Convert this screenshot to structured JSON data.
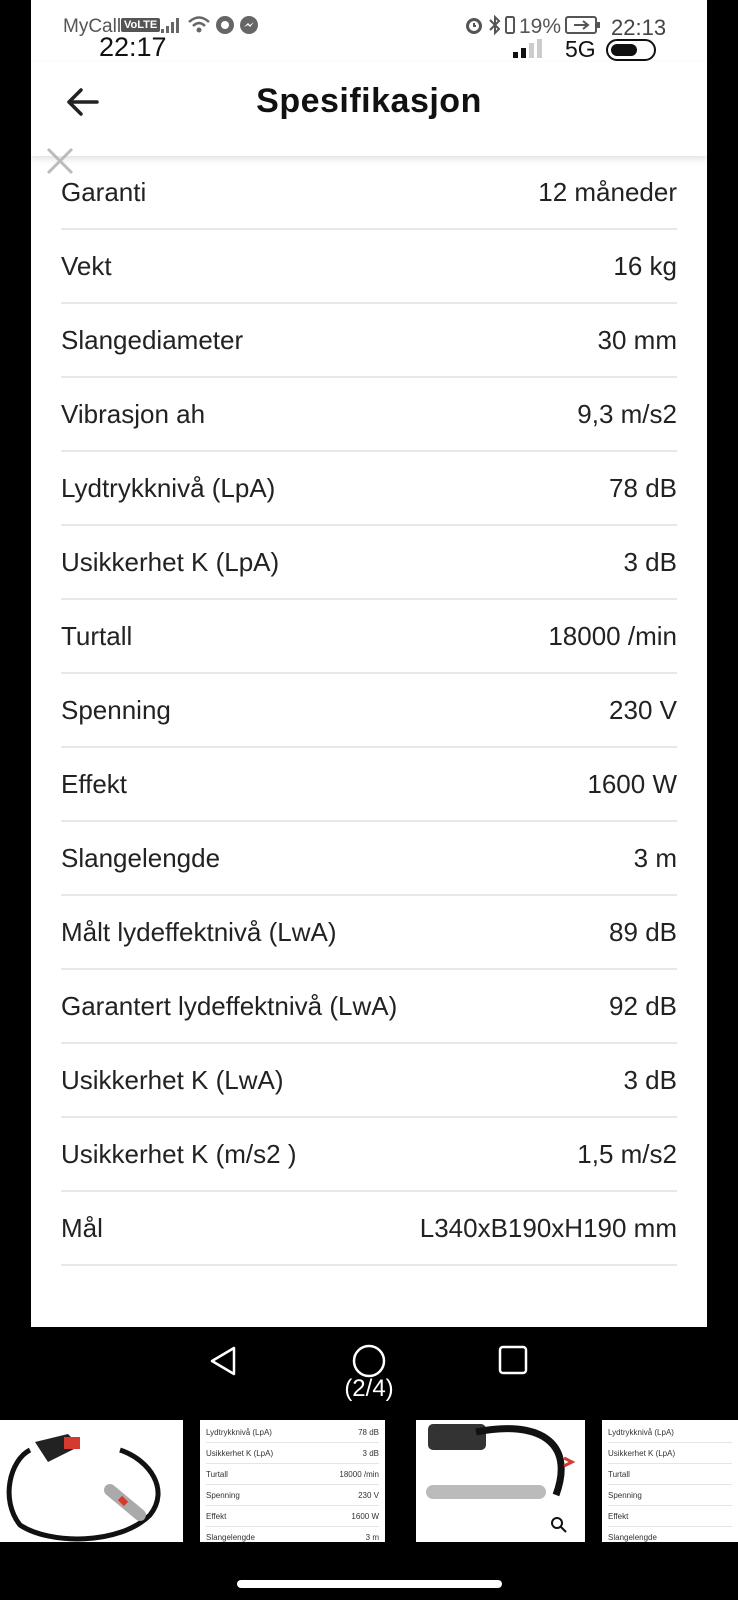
{
  "status_bar": {
    "carrier": "MyCall",
    "volte_badge": "VoLTE",
    "time_large": "22:17",
    "battery_percent": "19%",
    "time_right": "22:13",
    "network": "5G"
  },
  "header": {
    "title": "Spesifikasjon"
  },
  "specs": [
    {
      "label": "Garanti",
      "value": "12 måneder"
    },
    {
      "label": "Vekt",
      "value": "16 kg"
    },
    {
      "label": "Slangediameter",
      "value": "30 mm"
    },
    {
      "label": "Vibrasjon ah",
      "value": "9,3 m/s2"
    },
    {
      "label": "Lydtrykknivå (LpA)",
      "value": "78 dB"
    },
    {
      "label": "Usikkerhet K (LpA)",
      "value": "3 dB"
    },
    {
      "label": "Turtall",
      "value": "18000 /min"
    },
    {
      "label": "Spenning",
      "value": "230 V"
    },
    {
      "label": "Effekt",
      "value": "1600 W"
    },
    {
      "label": "Slangelengde",
      "value": "3 m"
    },
    {
      "label": "Målt lydeffektnivå (LwA)",
      "value": "89 dB"
    },
    {
      "label": "Garantert lydeffektnivå (LwA)",
      "value": "92 dB"
    },
    {
      "label": "Usikkerhet K (LwA)",
      "value": "3 dB"
    },
    {
      "label": "Usikkerhet K (m/s2 )",
      "value": "1,5 m/s2"
    },
    {
      "label": "Mål",
      "value": "L340xB190xH190 mm"
    }
  ],
  "gallery": {
    "pager": "(2/4)",
    "thumb2_rows": [
      {
        "label": "Lydtrykknivå (LpA)",
        "value": "78 dB"
      },
      {
        "label": "Usikkerhet K (LpA)",
        "value": "3 dB"
      },
      {
        "label": "Turtall",
        "value": "18000 /min"
      },
      {
        "label": "Spenning",
        "value": "230 V"
      },
      {
        "label": "Effekt",
        "value": "1600 W"
      },
      {
        "label": "Slangelengde",
        "value": "3 m"
      }
    ],
    "thumb4_rows": [
      {
        "label": "Lydtrykknivå (LpA)"
      },
      {
        "label": "Usikkerhet K (LpA)"
      },
      {
        "label": "Turtall"
      },
      {
        "label": "Spenning"
      },
      {
        "label": "Effekt"
      },
      {
        "label": "Slangelengde"
      }
    ]
  },
  "icons": [
    "alarm-icon",
    "bluetooth-icon",
    "vibrate-icon",
    "battery-icon",
    "wifi-icon",
    "signal-icon",
    "chrome-icon",
    "messenger-icon",
    "back-arrow-icon",
    "close-icon",
    "nav-back-icon",
    "nav-home-icon",
    "nav-recents-icon",
    "zoom-icon"
  ]
}
